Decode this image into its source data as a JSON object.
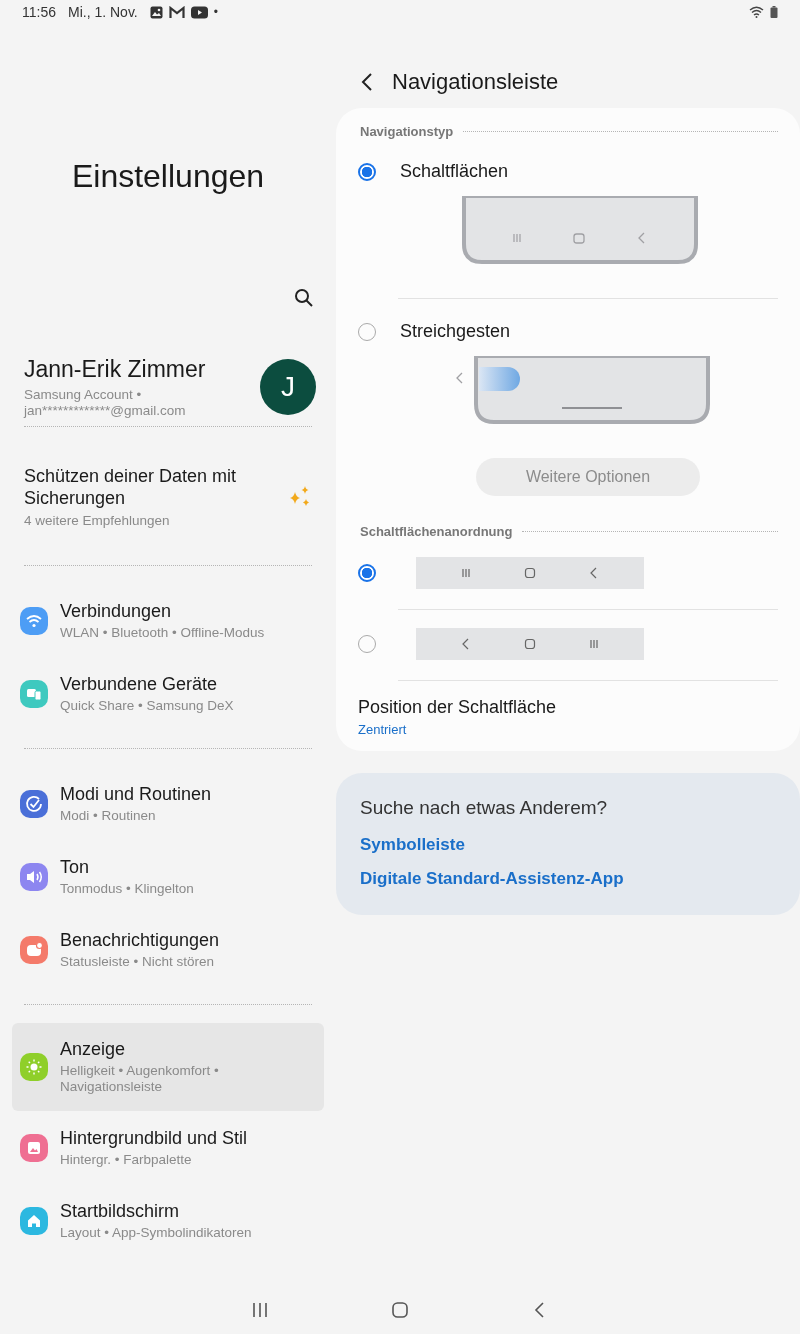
{
  "status_bar": {
    "time": "11:56",
    "date": "Mi., 1. Nov.",
    "dot": "•"
  },
  "settings": {
    "title": "Einstellungen",
    "account": {
      "name": "Jann-Erik Zimmer",
      "detail": "Samsung Account • jan*************@gmail.com",
      "avatar_initial": "J"
    },
    "suggestion": {
      "title": "Schützen deiner Daten mit Sicherungen",
      "subtitle": "4 weitere Empfehlungen"
    },
    "groups": [
      [
        {
          "title": "Verbindungen",
          "subtitle": "WLAN • Bluetooth • Offline-Modus",
          "color": "#4d9df5",
          "selected": false
        },
        {
          "title": "Verbundene Geräte",
          "subtitle": "Quick Share • Samsung DeX",
          "color": "#3ec9bf",
          "selected": false
        }
      ],
      [
        {
          "title": "Modi und Routinen",
          "subtitle": "Modi • Routinen",
          "color": "#4a6fd8",
          "selected": false
        },
        {
          "title": "Ton",
          "subtitle": "Tonmodus • Klingelton",
          "color": "#8d86f0",
          "selected": false
        },
        {
          "title": "Benachrichtigungen",
          "subtitle": "Statusleiste • Nicht stören",
          "color": "#f47a6a",
          "selected": false
        }
      ],
      [
        {
          "title": "Anzeige",
          "subtitle": "Helligkeit • Augenkomfort • Navigationsleiste",
          "color": "#8fcf2a",
          "selected": true
        },
        {
          "title": "Hintergrundbild und Stil",
          "subtitle": "Hintergr. • Farbpalette",
          "color": "#ef6f92",
          "selected": false
        },
        {
          "title": "Startbildschirm",
          "subtitle": "Layout • App-Symbolindikatoren",
          "color": "#2cb8e0",
          "selected": false
        }
      ]
    ]
  },
  "detail": {
    "title": "Navigationsleiste",
    "navigation_type": {
      "header": "Navigationstyp",
      "options": [
        {
          "label": "Schaltflächen",
          "kind": "buttons",
          "selected": true
        },
        {
          "label": "Streichgesten",
          "kind": "gestures",
          "selected": false
        }
      ],
      "more_options": {
        "label": "Weitere Optionen",
        "disabled": true
      }
    },
    "button_order": {
      "header": "Schaltflächenanordnung",
      "options": [
        {
          "kind": "standard",
          "selected": true
        },
        {
          "kind": "reversed",
          "selected": false
        }
      ]
    },
    "position": {
      "title": "Position der Schaltfläche",
      "value": "Zentriert"
    },
    "related": {
      "title": "Suche nach etwas Anderem?",
      "links": [
        "Symbolleiste",
        "Digitale Standard-Assistenz-App"
      ]
    }
  }
}
